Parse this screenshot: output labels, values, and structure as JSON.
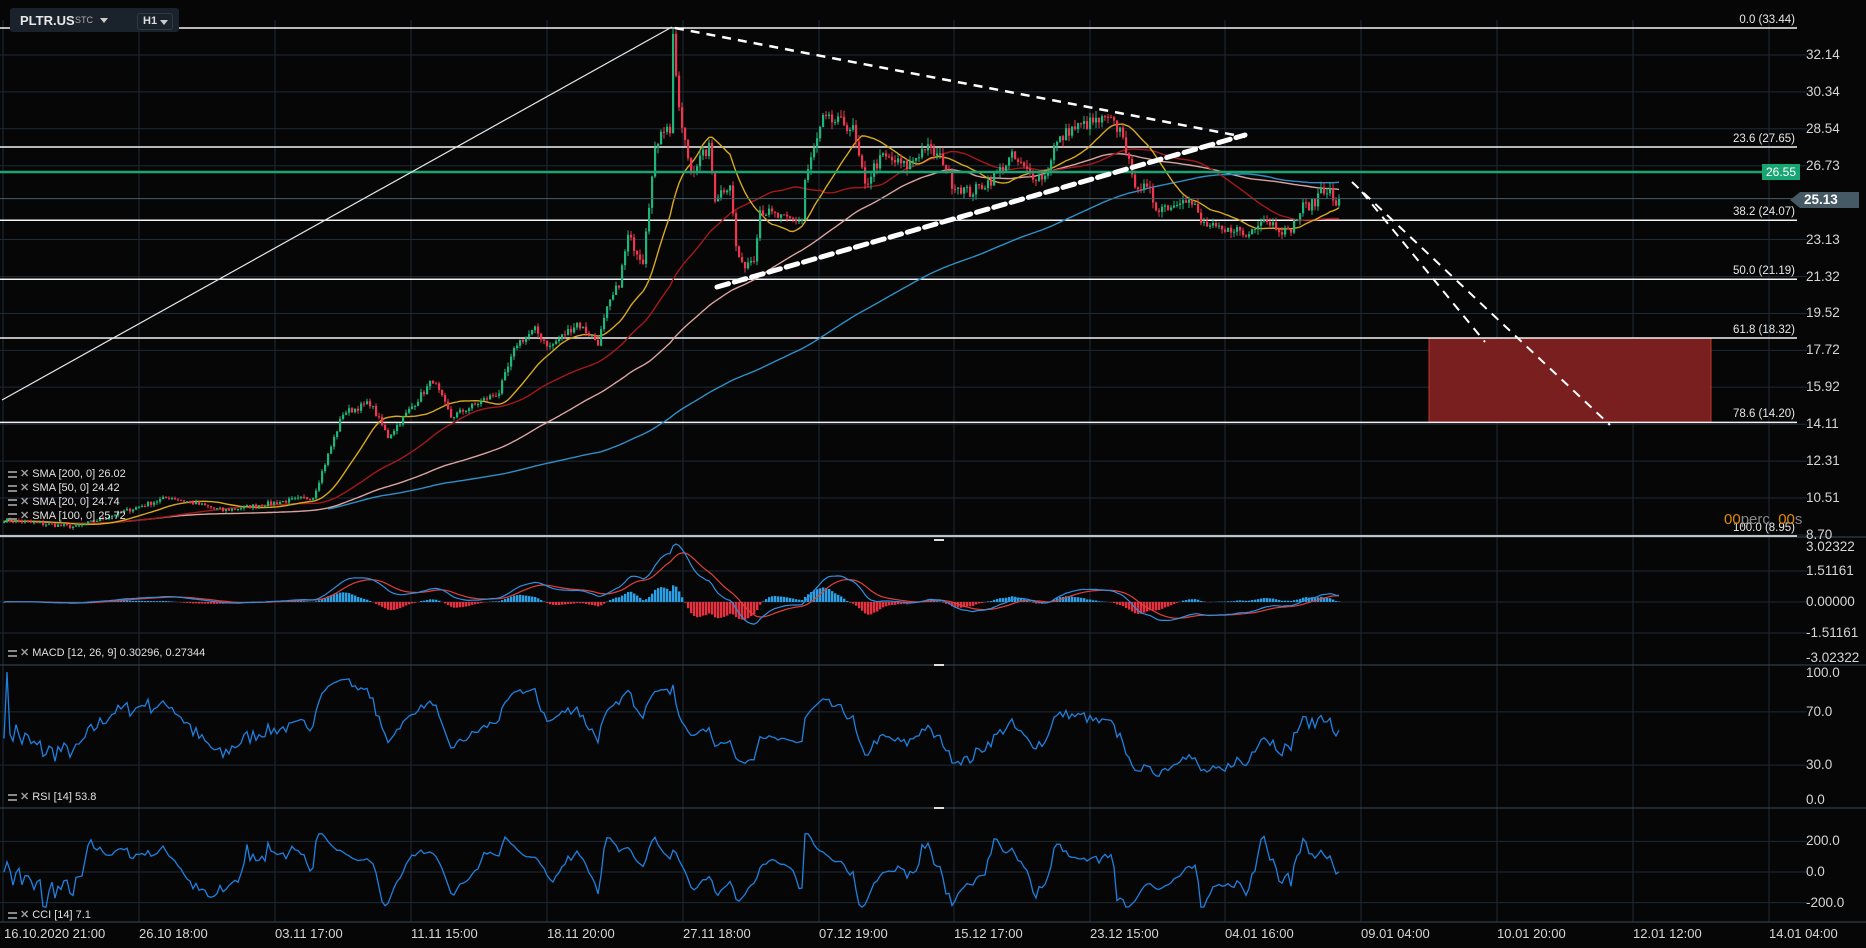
{
  "header": {
    "symbol": "PLTR.US",
    "market": "STC",
    "timeframe": "H1"
  },
  "price_axis": [
    "32.14",
    "30.34",
    "28.54",
    "26.73",
    "23.13",
    "21.32",
    "19.52",
    "17.72",
    "15.92",
    "14.11",
    "12.31",
    "10.51",
    "8.70"
  ],
  "price_axis_values": [
    32.14,
    30.34,
    28.54,
    26.73,
    23.13,
    21.32,
    19.52,
    17.72,
    15.92,
    14.11,
    12.31,
    10.51,
    8.7
  ],
  "current_price": {
    "label": "25.13",
    "value": 25.13
  },
  "alert_line": {
    "label": "26.55",
    "value": 26.55,
    "color": "#17a673"
  },
  "fibonacci": [
    {
      "label": "0.0 (33.44)",
      "value": 33.44
    },
    {
      "label": "23.6 (27.65)",
      "value": 27.65
    },
    {
      "label": "38.2 (24.07)",
      "value": 24.07
    },
    {
      "label": "50.0 (21.19)",
      "value": 21.19
    },
    {
      "label": "61.8 (18.32)",
      "value": 18.32
    },
    {
      "label": "78.6 (14.20)",
      "value": 14.2
    },
    {
      "label": "100.0 (8.95)",
      "value": 8.95
    }
  ],
  "countdown": {
    "a": "00",
    "b": "perc.",
    "c": "00",
    "d": "s"
  },
  "legends": {
    "sma200": "SMA [200, 0] 26.02",
    "sma50": "SMA [50, 0] 24.42",
    "sma20": "SMA [20, 0] 24.74",
    "sma100": "SMA [100, 0] 25.72",
    "macd": "MACD [12, 26, 9] 0.30296, 0.27344",
    "rsi": "RSI [14] 53.8",
    "cci": "CCI [14] 7.1"
  },
  "macd_axis": [
    "3.02322",
    "1.51161",
    "0.00000",
    "-1.51161",
    "-3.02322"
  ],
  "rsi_axis": [
    "100.0",
    "70.0",
    "30.0",
    "0.0"
  ],
  "cci_axis": [
    "200.0",
    "0.0",
    "-200.0"
  ],
  "time_axis": [
    "16.10.2020  21:00",
    "26.10  18:00",
    "03.11  17:00",
    "11.11  15:00",
    "18.11  20:00",
    "27.11  18:00",
    "07.12  19:00",
    "15.12  17:00",
    "23.12  15:00",
    "04.01  16:00",
    "09.01  04:00",
    "10.01  20:00",
    "12.01  12:00",
    "14.01  04:00"
  ],
  "colors": {
    "up": "#1fb57a",
    "down": "#f0364f",
    "sma20": "#d8a91c",
    "sma50": "#a3181b",
    "sma100": "#d9a3a0",
    "sma200": "#2e8fc6",
    "macd": "#2f8fe0",
    "signal": "#e0403a",
    "hist_pos": "#2aa0e6",
    "hist_neg": "#e8313f",
    "rsi": "#1e80e0",
    "target_zone": "#7a1f1f"
  },
  "chart_data": {
    "type": "candlestick",
    "title": "PLTR.US H1",
    "close_path_bar_price": [
      [
        0,
        9.43
      ],
      [
        24,
        9.09
      ],
      [
        55,
        10.56
      ],
      [
        73,
        9.9
      ],
      [
        103,
        10.56
      ],
      [
        113,
        14.66
      ],
      [
        122,
        15.15
      ],
      [
        128,
        13.5
      ],
      [
        143,
        16.27
      ],
      [
        149,
        14.46
      ],
      [
        165,
        15.68
      ],
      [
        171,
        18.07
      ],
      [
        177,
        18.7
      ],
      [
        182,
        17.88
      ],
      [
        191,
        19.05
      ],
      [
        198,
        18.12
      ],
      [
        201,
        19.69
      ],
      [
        205,
        21.0
      ],
      [
        208,
        23.25
      ],
      [
        213,
        22.13
      ],
      [
        214,
        23.74
      ],
      [
        217,
        27.35
      ],
      [
        219,
        28.62
      ],
      [
        222,
        28.48
      ],
      [
        223,
        33.2
      ],
      [
        224,
        30.8
      ],
      [
        226,
        28.48
      ],
      [
        229,
        26.5
      ],
      [
        235,
        27.6
      ],
      [
        237,
        25.2
      ],
      [
        242,
        25.9
      ],
      [
        244,
        22.77
      ],
      [
        246,
        21.8
      ],
      [
        250,
        22.3
      ],
      [
        252,
        24.6
      ],
      [
        260,
        24.1
      ],
      [
        266,
        24.1
      ],
      [
        267,
        26.04
      ],
      [
        273,
        28.97
      ],
      [
        280,
        28.8
      ],
      [
        283,
        28.48
      ],
      [
        287,
        25.7
      ],
      [
        290,
        26.67
      ],
      [
        293,
        27.16
      ],
      [
        301,
        26.7
      ],
      [
        307,
        27.65
      ],
      [
        313,
        27.0
      ],
      [
        316,
        25.89
      ],
      [
        322,
        25.4
      ],
      [
        329,
        26.04
      ],
      [
        336,
        27.16
      ],
      [
        342,
        26.3
      ],
      [
        347,
        26.2
      ],
      [
        350,
        27.65
      ],
      [
        355,
        28.48
      ],
      [
        362,
        28.82
      ],
      [
        368,
        28.97
      ],
      [
        373,
        28.33
      ],
      [
        376,
        26.04
      ],
      [
        382,
        25.4
      ],
      [
        384,
        24.72
      ],
      [
        390,
        24.8
      ],
      [
        393,
        25.3
      ],
      [
        397,
        24.7
      ],
      [
        399,
        23.94
      ],
      [
        407,
        23.45
      ],
      [
        410,
        23.74
      ],
      [
        414,
        23.25
      ],
      [
        419,
        24.23
      ],
      [
        423,
        23.9
      ],
      [
        428,
        23.45
      ],
      [
        433,
        24.72
      ],
      [
        437,
        24.91
      ],
      [
        439,
        25.7
      ],
      [
        442,
        25.5
      ],
      [
        443,
        24.9
      ],
      [
        445,
        24.96
      ]
    ],
    "target_zone": {
      "from": 14.2,
      "to": 18.32
    },
    "yrange": [
      8.7,
      33.44
    ],
    "indicators": [
      "SMA 20",
      "SMA 50",
      "SMA 100",
      "SMA 200",
      "MACD 12,26,9",
      "RSI 14",
      "CCI 14"
    ]
  }
}
